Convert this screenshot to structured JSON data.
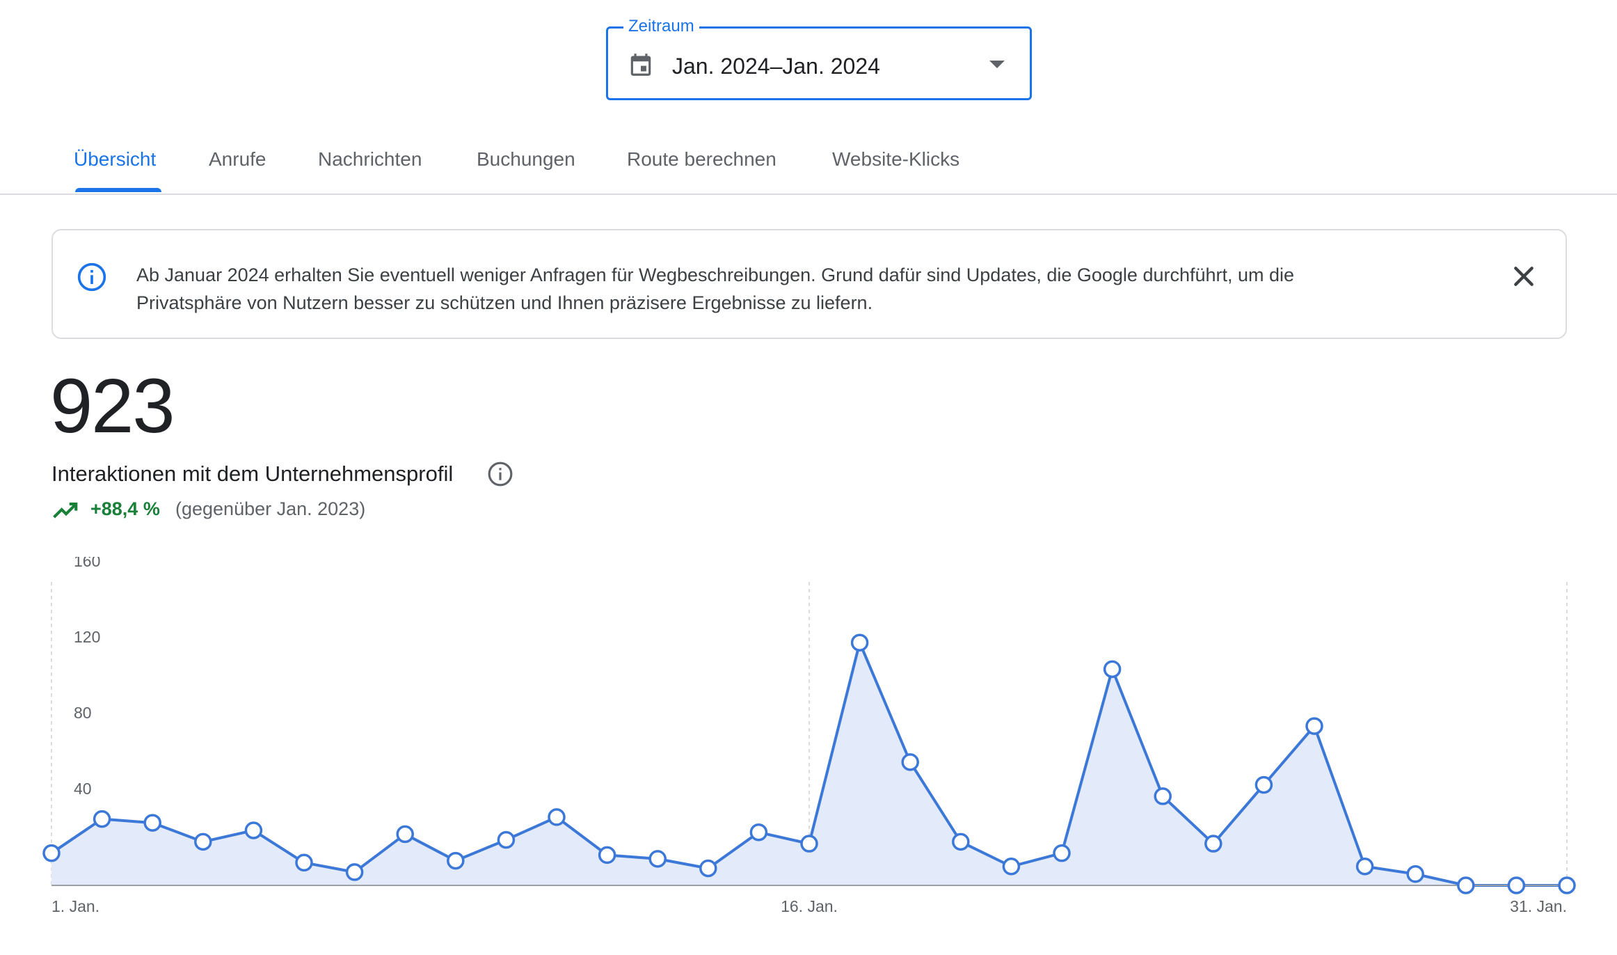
{
  "date_range": {
    "label": "Zeitraum",
    "value": "Jan. 2024–Jan. 2024"
  },
  "tabs": [
    {
      "label": "Übersicht",
      "active": true
    },
    {
      "label": "Anrufe",
      "active": false
    },
    {
      "label": "Nachrichten",
      "active": false
    },
    {
      "label": "Buchungen",
      "active": false
    },
    {
      "label": "Route berechnen",
      "active": false
    },
    {
      "label": "Website-Klicks",
      "active": false
    }
  ],
  "banner": {
    "text_line1": "Ab Januar 2024 erhalten Sie eventuell weniger Anfragen für Wegbeschreibungen. Grund dafür sind Updates, die Google durchführt, um die",
    "text_line2": "Privatsphäre von Nutzern besser zu schützen und Ihnen präzisere Ergebnisse zu liefern.",
    "icon": "info-icon",
    "close_icon": "close-icon"
  },
  "kpi": {
    "value": "923",
    "label": "Interaktionen mit dem Unternehmensprofil",
    "change": "+88,4 %",
    "comparison": "(gegenüber Jan. 2023)"
  },
  "colors": {
    "accent": "#1a73e8",
    "series_line": "#3c78d8",
    "series_fill": "#e3eaf9",
    "positive": "#188038"
  },
  "chart_data": {
    "type": "area",
    "x": [
      "1. Jan.",
      "2. Jan.",
      "3. Jan.",
      "4. Jan.",
      "5. Jan.",
      "6. Jan.",
      "7. Jan.",
      "8. Jan.",
      "9. Jan.",
      "10. Jan.",
      "11. Jan.",
      "12. Jan.",
      "13. Jan.",
      "14. Jan.",
      "15. Jan.",
      "16. Jan.",
      "17. Jan.",
      "18. Jan.",
      "19. Jan.",
      "20. Jan.",
      "21. Jan.",
      "22. Jan.",
      "23. Jan.",
      "24. Jan.",
      "25. Jan.",
      "26. Jan.",
      "27. Jan.",
      "28. Jan.",
      "29. Jan.",
      "30. Jan.",
      "31. Jan."
    ],
    "values": [
      17,
      35,
      33,
      23,
      29,
      12,
      7,
      27,
      13,
      24,
      36,
      16,
      14,
      9,
      28,
      22,
      128,
      65,
      23,
      10,
      17,
      114,
      47,
      22,
      53,
      84,
      10,
      6,
      0,
      0,
      0
    ],
    "x_tick_labels": [
      "1. Jan.",
      "16. Jan.",
      "31. Jan."
    ],
    "y_ticks": [
      40,
      80,
      120,
      160
    ],
    "ylim": [
      0,
      160
    ],
    "grid": "vertical dashed lines at 1., 16. and 31. Jan."
  }
}
